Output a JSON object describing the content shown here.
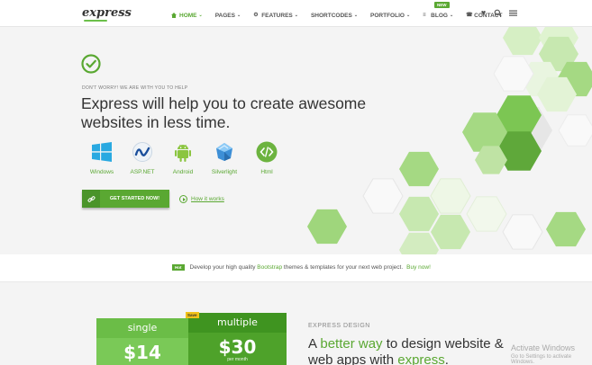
{
  "header": {
    "logo": "express",
    "nav": [
      {
        "label": "HOME",
        "icon": "home-icon",
        "active": true
      },
      {
        "label": "PAGES",
        "active": false
      },
      {
        "label": "FEATURES",
        "icon": "gear-icon",
        "active": false
      },
      {
        "label": "SHORTCODES",
        "active": false
      },
      {
        "label": "PORTFOLIO",
        "active": false
      },
      {
        "label": "BLOG",
        "icon": "list-icon",
        "active": false
      },
      {
        "label": "CONTACT",
        "icon": "phone-icon",
        "active": false
      }
    ],
    "new_badge": "NEW",
    "icons": [
      "heart-icon",
      "search-icon",
      "menu-icon"
    ]
  },
  "hero": {
    "eyebrow": "DON'T WORRY! WE ARE WITH YOU TO HELP",
    "headline": "Express will help you to create awesome websites in less time.",
    "technologies": [
      {
        "label": "Windows",
        "icon": "windows-icon"
      },
      {
        "label": "ASP.NET",
        "icon": "aspnet-icon"
      },
      {
        "label": "Android",
        "icon": "android-icon"
      },
      {
        "label": "Silverlight",
        "icon": "silverlight-icon"
      },
      {
        "label": "Html",
        "icon": "html-icon"
      }
    ],
    "cta_label": "GET STARTED NOW!",
    "how_it_works": "How it works"
  },
  "promo": {
    "badge": "Hot",
    "text_before": "Develop your high quality ",
    "text_link": "Bootstrap",
    "text_after": " themes & templates for your next web project.",
    "buy_now": "Buy now!"
  },
  "pricing": {
    "plans": [
      {
        "name": "single",
        "price": "$14"
      },
      {
        "name": "multiple",
        "price": "$30",
        "per": "per month"
      }
    ],
    "save_badge": "Save"
  },
  "design": {
    "eyebrow": "EXPRESS DESIGN",
    "headline_1": "A ",
    "headline_green_1": "better way",
    "headline_2": " to design website &",
    "headline_3": "web apps with ",
    "headline_green_2": "express",
    "headline_4": "."
  },
  "watermark": {
    "line1": "Activate Windows",
    "line2": "Go to Settings to activate Windows."
  },
  "colors": {
    "brand_green": "#5aa832",
    "light_green": "#8fd16a",
    "hero_bg": "#f4f4f4"
  }
}
